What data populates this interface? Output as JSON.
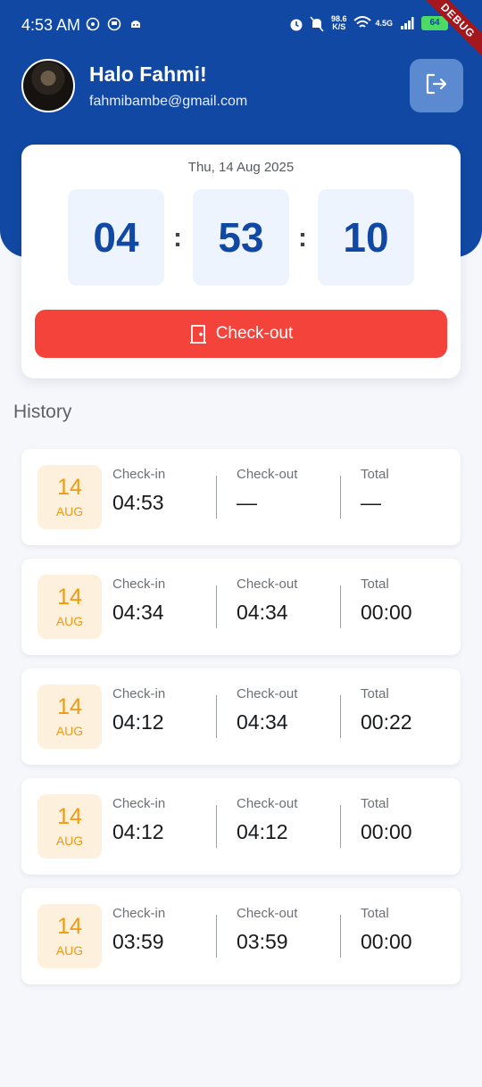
{
  "status_bar": {
    "time": "4:53 AM",
    "net_speed_value": "98.6",
    "net_speed_unit": "K/S",
    "net_type": "4.5G",
    "battery": "64",
    "debug_banner": "DEBUG"
  },
  "header": {
    "greeting": "Halo Fahmi!",
    "email": "fahmibambe@gmail.com",
    "background_color": "#1048a3"
  },
  "clock": {
    "date": "Thu, 14 Aug 2025",
    "hours": "04",
    "minutes": "53",
    "seconds": "10",
    "separator": ":",
    "checkout_label": "Check-out"
  },
  "history": {
    "title": "History",
    "labels": {
      "check_in": "Check-in",
      "check_out": "Check-out",
      "total": "Total"
    },
    "items": [
      {
        "day": "14",
        "month": "AUG",
        "check_in": "04:53",
        "check_out": "—",
        "total": "—"
      },
      {
        "day": "14",
        "month": "AUG",
        "check_in": "04:34",
        "check_out": "04:34",
        "total": "00:00"
      },
      {
        "day": "14",
        "month": "AUG",
        "check_in": "04:12",
        "check_out": "04:34",
        "total": "00:22"
      },
      {
        "day": "14",
        "month": "AUG",
        "check_in": "04:12",
        "check_out": "04:12",
        "total": "00:00"
      },
      {
        "day": "14",
        "month": "AUG",
        "check_in": "03:59",
        "check_out": "03:59",
        "total": "00:00"
      }
    ]
  },
  "colors": {
    "primary": "#1048a3",
    "checkout_button": "#f4433a",
    "date_badge_bg": "#fdf0dc",
    "date_badge_text": "#f09a12"
  }
}
